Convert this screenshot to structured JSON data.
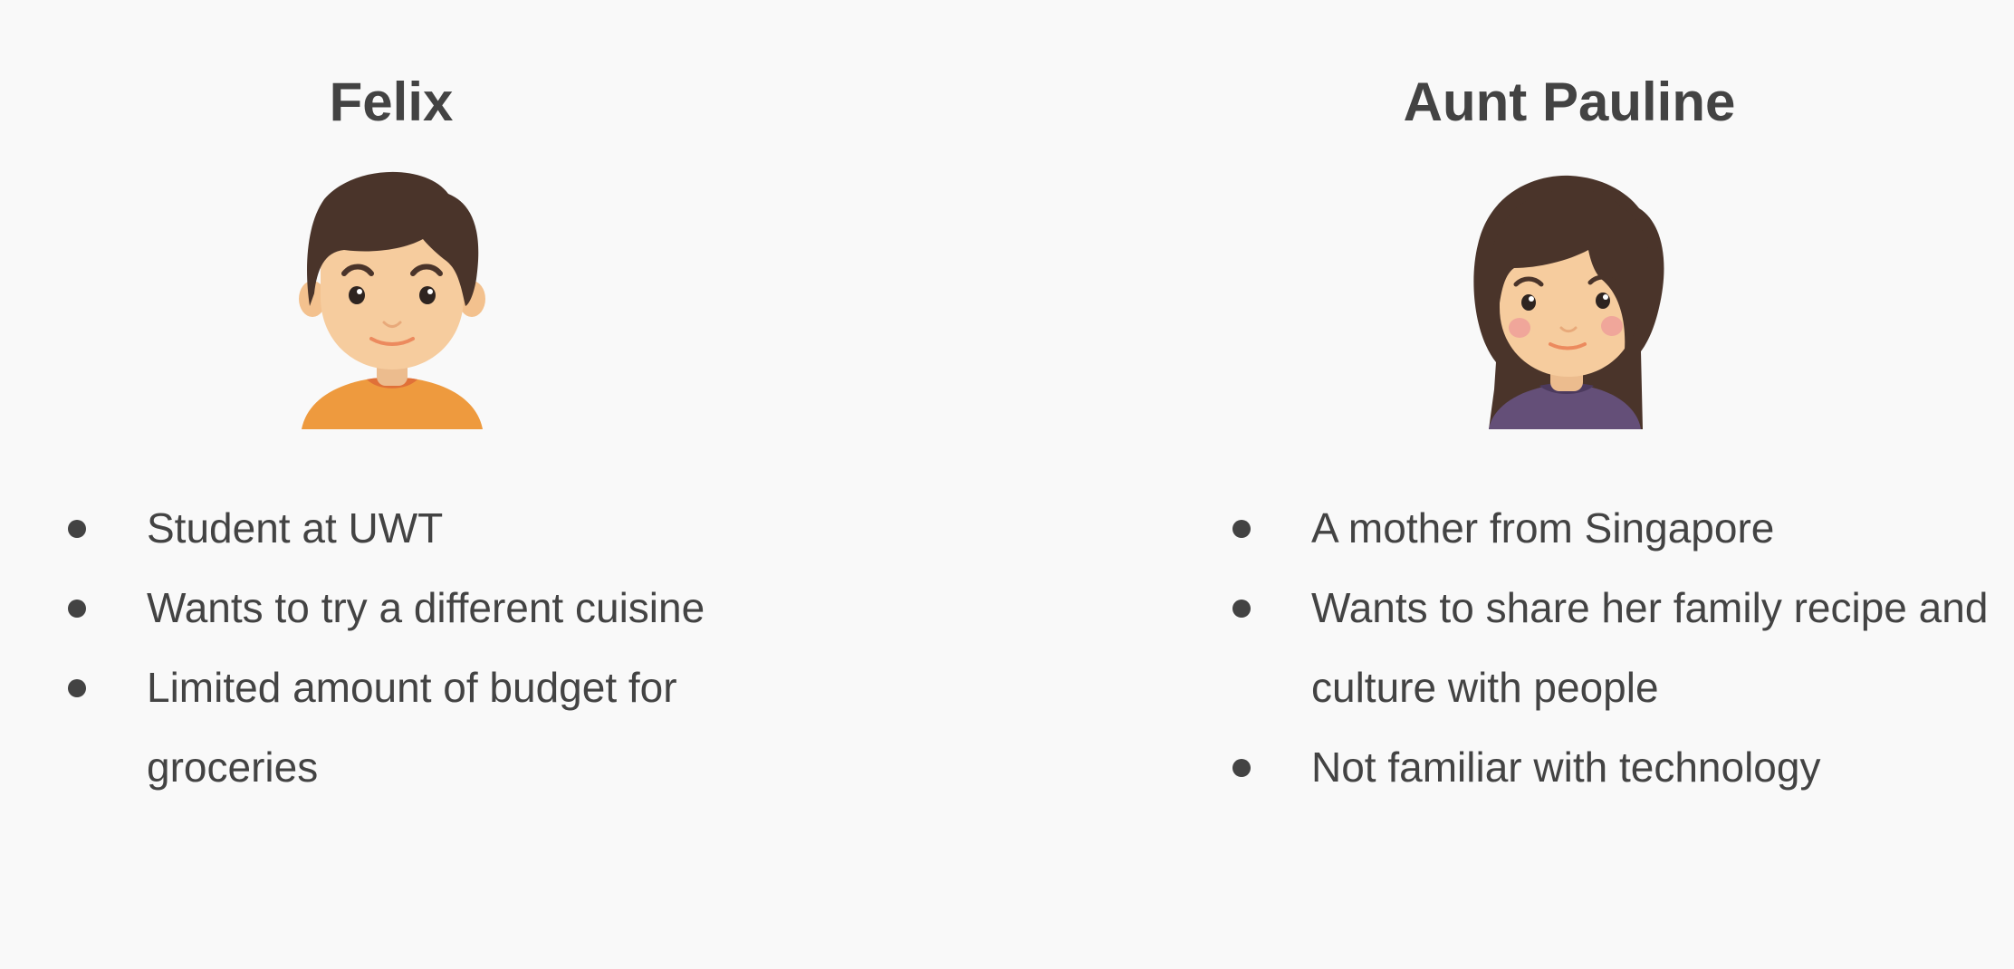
{
  "personas": [
    {
      "name": "Felix",
      "avatar_icon": "boy-avatar-icon",
      "bullets": [
        "Student at UWT",
        "Wants to try a different cuisine",
        "Limited amount of budget for groceries"
      ]
    },
    {
      "name": "Aunt Pauline",
      "avatar_icon": "woman-avatar-icon",
      "bullets": [
        "A mother from Singapore",
        "Wants to share her family recipe and culture with people",
        "Not familiar with technology"
      ]
    }
  ],
  "colors": {
    "background": "#f9f9f9",
    "text": "#434343",
    "hair": "#4a342a",
    "skin": "#f6cc9e",
    "felix_shirt": "#ee9a3e",
    "felix_collar": "#e07038",
    "pauline_shirt": "#644f78",
    "pauline_collar": "#4c3a5e",
    "blush": "#f0a69a"
  }
}
